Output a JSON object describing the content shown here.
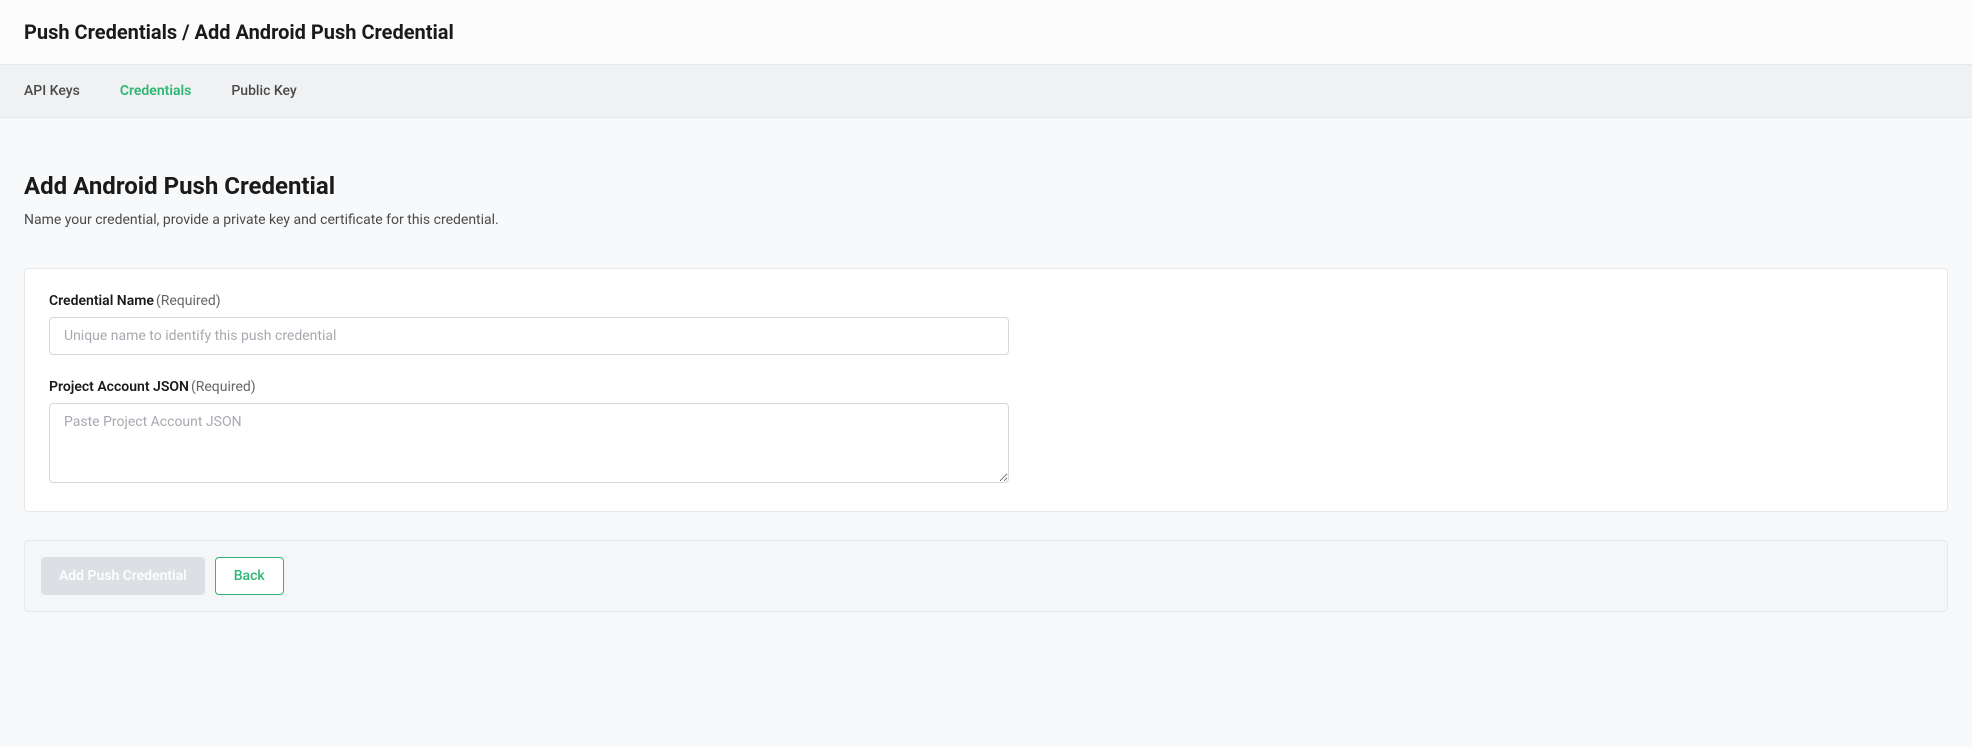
{
  "header": {
    "breadcrumb_parent": "Push Credentials",
    "breadcrumb_separator": " / ",
    "breadcrumb_current": "Add Android Push Credential"
  },
  "tabs": [
    {
      "label": "API Keys",
      "active": false
    },
    {
      "label": "Credentials",
      "active": true
    },
    {
      "label": "Public Key",
      "active": false
    }
  ],
  "page": {
    "title": "Add Android Push Credential",
    "subtitle": "Name your credential, provide a private key and certificate for this credential."
  },
  "form": {
    "credential_name": {
      "label": "Credential Name",
      "required_text": "(Required)",
      "placeholder": "Unique name to identify this push credential",
      "value": ""
    },
    "project_account_json": {
      "label": "Project Account JSON",
      "required_text": "(Required)",
      "placeholder": "Paste Project Account JSON",
      "value": ""
    }
  },
  "actions": {
    "submit_label": "Add Push Credential",
    "back_label": "Back"
  }
}
